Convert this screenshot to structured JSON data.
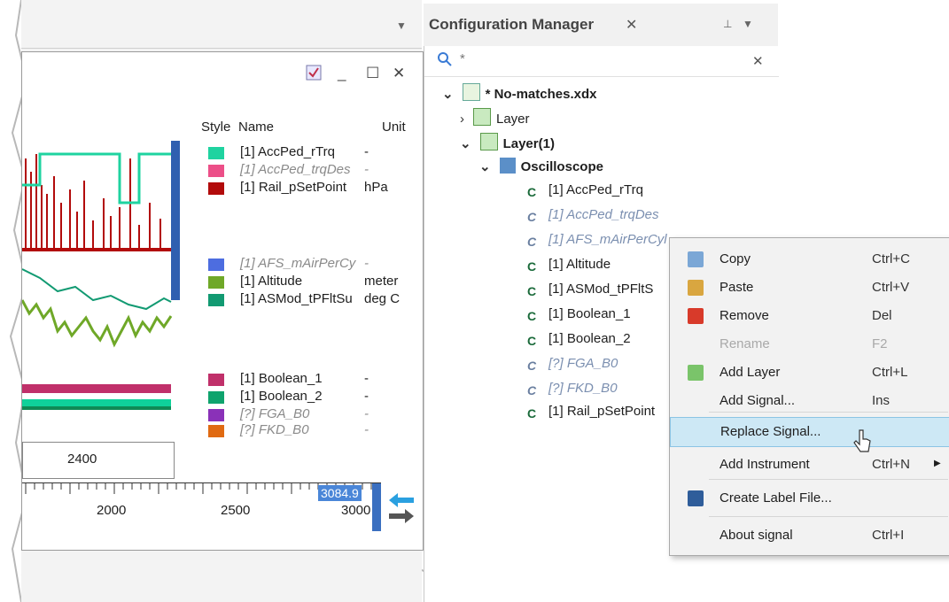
{
  "left_panel": {
    "legend": {
      "headers": {
        "style": "Style",
        "name": "Name",
        "unit": "Unit"
      },
      "rows": [
        {
          "name": "[1] AccPed_rTrq",
          "unit": "-",
          "color": "#1fd3a0",
          "dimmed": false
        },
        {
          "name": "[1] AccPed_trqDes",
          "unit": "-",
          "color": "#ec4f88",
          "dimmed": true
        },
        {
          "name": "[1] Rail_pSetPoint",
          "unit": "hPa",
          "color": "#b20b0b",
          "dimmed": false
        },
        {
          "name": "[1] AFS_mAirPerCy",
          "unit": "-",
          "color": "#4d6de0",
          "dimmed": true
        },
        {
          "name": "[1] Altitude",
          "unit": "meter",
          "color": "#6fa828",
          "dimmed": false
        },
        {
          "name": "[1] ASMod_tPFltSu",
          "unit": "deg C",
          "color": "#129a72",
          "dimmed": false
        },
        {
          "name": "[1] Boolean_1",
          "unit": "-",
          "color": "#c0306a",
          "dimmed": false
        },
        {
          "name": "[1] Boolean_2",
          "unit": "-",
          "color": "#0fa36d",
          "dimmed": false
        },
        {
          "name": "[?] FGA_B0",
          "unit": "-",
          "color": "#8a31b8",
          "dimmed": true
        },
        {
          "name": "[?] FKD_B0",
          "unit": "-",
          "color": "#e06a12",
          "dimmed": true
        }
      ]
    },
    "time_box_value": "2400",
    "axis_ticks": [
      "2000",
      "2500",
      "3000"
    ],
    "cursor_value": "3084.9"
  },
  "config_manager": {
    "title": "Configuration Manager",
    "search_text": "*",
    "tree": [
      {
        "label": "* No-matches.xdx",
        "level": 0,
        "bold": true
      },
      {
        "label": "Layer",
        "level": 1,
        "bold": false
      },
      {
        "label": "Layer(1)",
        "level": 1,
        "bold": true
      },
      {
        "label": "Oscilloscope",
        "level": 2,
        "bold": true
      },
      {
        "label": "[1] AccPed_rTrq",
        "level": 3,
        "dim": false
      },
      {
        "label": "[1] AccPed_trqDes",
        "level": 3,
        "dim": true
      },
      {
        "label": "[1] AFS_mAirPerCyl",
        "level": 3,
        "dim": true
      },
      {
        "label": "[1] Altitude",
        "level": 3,
        "dim": false
      },
      {
        "label": "[1] ASMod_tPFltS",
        "level": 3,
        "dim": false
      },
      {
        "label": "[1] Boolean_1",
        "level": 3,
        "dim": false
      },
      {
        "label": "[1] Boolean_2",
        "level": 3,
        "dim": false
      },
      {
        "label": "[?] FGA_B0",
        "level": 3,
        "dim": true
      },
      {
        "label": "[?] FKD_B0",
        "level": 3,
        "dim": true
      },
      {
        "label": "[1] Rail_pSetPoint",
        "level": 3,
        "dim": false
      }
    ]
  },
  "context_menu": {
    "items": [
      {
        "label": "Copy",
        "shortcut": "Ctrl+C",
        "icon": "copy-icon",
        "disabled": false
      },
      {
        "label": "Paste",
        "shortcut": "Ctrl+V",
        "icon": "paste-icon",
        "disabled": false
      },
      {
        "label": "Remove",
        "shortcut": "Del",
        "icon": "remove-icon",
        "disabled": false
      },
      {
        "label": "Rename",
        "shortcut": "F2",
        "icon": "",
        "disabled": true
      },
      {
        "label": "Add Layer",
        "shortcut": "Ctrl+L",
        "icon": "add-layer-icon",
        "disabled": false
      },
      {
        "label": "Add Signal...",
        "shortcut": "Ins",
        "icon": "",
        "disabled": false
      },
      {
        "label": "Replace Signal...",
        "shortcut": "",
        "icon": "",
        "disabled": false,
        "highlighted": true
      },
      {
        "label": "Add Instrument",
        "shortcut": "Ctrl+N",
        "icon": "",
        "disabled": false,
        "submenu": true
      },
      {
        "label": "Create Label File...",
        "shortcut": "",
        "icon": "save-icon",
        "disabled": false
      },
      {
        "label": "About signal",
        "shortcut": "Ctrl+I",
        "icon": "",
        "disabled": false
      }
    ]
  }
}
